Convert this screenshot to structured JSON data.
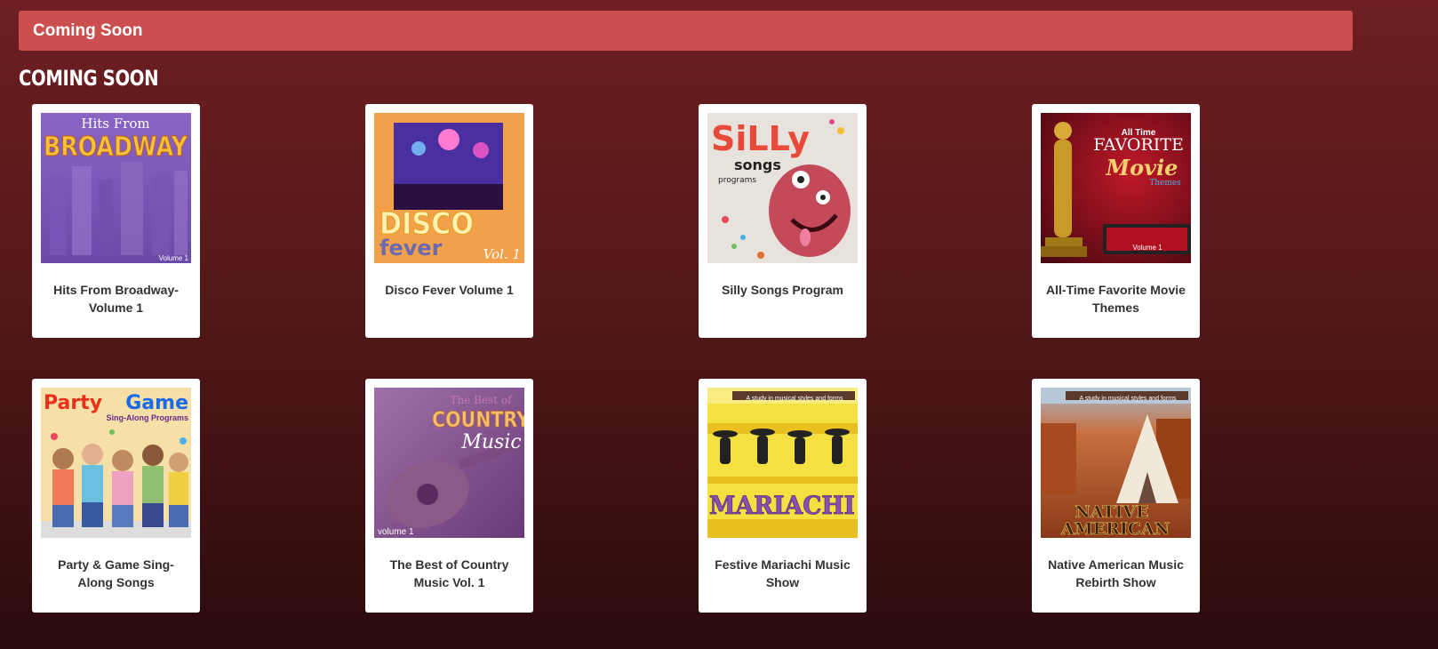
{
  "banner": {
    "title": "Coming Soon"
  },
  "section": {
    "heading": "COMING SOON"
  },
  "products": [
    {
      "title": "Hits From Broadway- Volume 1",
      "cover_text": [
        "Hits From",
        "BROADWAY",
        "Volume 1"
      ],
      "icon": "broadway-cover-icon"
    },
    {
      "title": "Disco Fever Volume 1",
      "cover_text": [
        "DISCO",
        "fever",
        "Vol. 1"
      ],
      "icon": "disco-cover-icon"
    },
    {
      "title": "Silly Songs Program",
      "cover_text": [
        "SiLLy",
        "songs",
        "programs"
      ],
      "icon": "silly-cover-icon"
    },
    {
      "title": "All-Time Favorite Movie Themes",
      "cover_text": [
        "All Time",
        "FAVORITE",
        "Movie",
        "Themes",
        "Volume 1"
      ],
      "icon": "movie-cover-icon"
    },
    {
      "title": "Party & Game Sing-Along Songs",
      "cover_text": [
        "Party",
        "Game",
        "Sing-Along Programs"
      ],
      "icon": "party-cover-icon"
    },
    {
      "title": "The Best of Country Music Vol. 1",
      "cover_text": [
        "The Best of",
        "COUNTRY",
        "Music",
        "volume 1"
      ],
      "icon": "country-cover-icon"
    },
    {
      "title": "Festive Mariachi Music Show",
      "cover_text": [
        "A study in musical styles and forms",
        "MARIACHI"
      ],
      "icon": "mariachi-cover-icon"
    },
    {
      "title": "Native American Music Rebirth Show",
      "cover_text": [
        "A study in musical styles and forms",
        "NATIVE",
        "AMERICAN"
      ],
      "icon": "native-cover-icon"
    }
  ]
}
